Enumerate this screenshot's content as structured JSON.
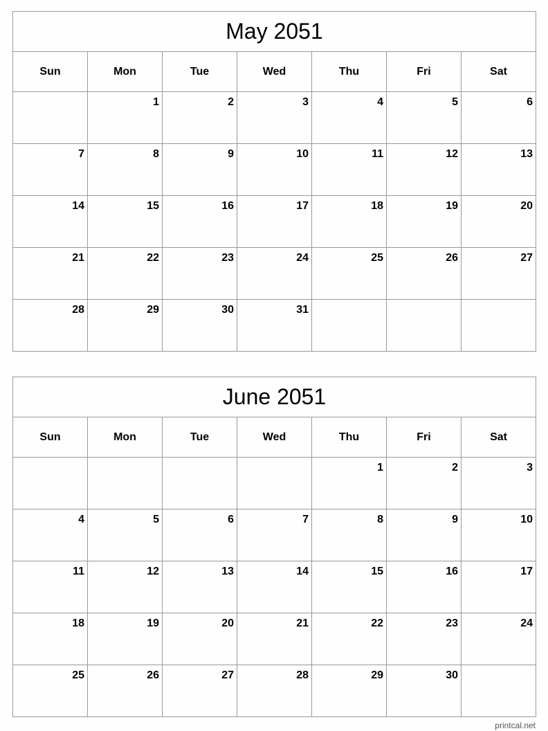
{
  "months": [
    {
      "title": "May 2051",
      "weekdays": [
        "Sun",
        "Mon",
        "Tue",
        "Wed",
        "Thu",
        "Fri",
        "Sat"
      ],
      "weeks": [
        [
          "",
          "1",
          "2",
          "3",
          "4",
          "5",
          "6"
        ],
        [
          "7",
          "8",
          "9",
          "10",
          "11",
          "12",
          "13"
        ],
        [
          "14",
          "15",
          "16",
          "17",
          "18",
          "19",
          "20"
        ],
        [
          "21",
          "22",
          "23",
          "24",
          "25",
          "26",
          "27"
        ],
        [
          "28",
          "29",
          "30",
          "31",
          "",
          "",
          ""
        ]
      ]
    },
    {
      "title": "June 2051",
      "weekdays": [
        "Sun",
        "Mon",
        "Tue",
        "Wed",
        "Thu",
        "Fri",
        "Sat"
      ],
      "weeks": [
        [
          "",
          "",
          "",
          "",
          "1",
          "2",
          "3"
        ],
        [
          "4",
          "5",
          "6",
          "7",
          "8",
          "9",
          "10"
        ],
        [
          "11",
          "12",
          "13",
          "14",
          "15",
          "16",
          "17"
        ],
        [
          "18",
          "19",
          "20",
          "21",
          "22",
          "23",
          "24"
        ],
        [
          "25",
          "26",
          "27",
          "28",
          "29",
          "30",
          ""
        ]
      ]
    }
  ],
  "footer": "printcal.net"
}
